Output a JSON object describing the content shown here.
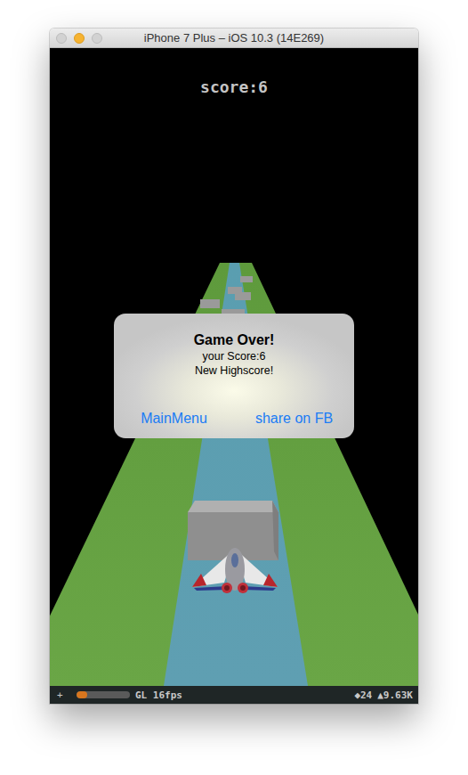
{
  "window": {
    "title": "iPhone 7 Plus – iOS 10.3 (14E269)"
  },
  "hud": {
    "score": "score:6"
  },
  "alert": {
    "title": "Game Over!",
    "lines": [
      "your Score:6",
      "New Highscore!"
    ],
    "buttons": [
      "MainMenu",
      "share on FB"
    ]
  },
  "stats_bar": {
    "plus": "+",
    "level": 0.2,
    "fps": "GL 16fps",
    "nodes": "◆24",
    "polygons": "▲9.63K"
  }
}
